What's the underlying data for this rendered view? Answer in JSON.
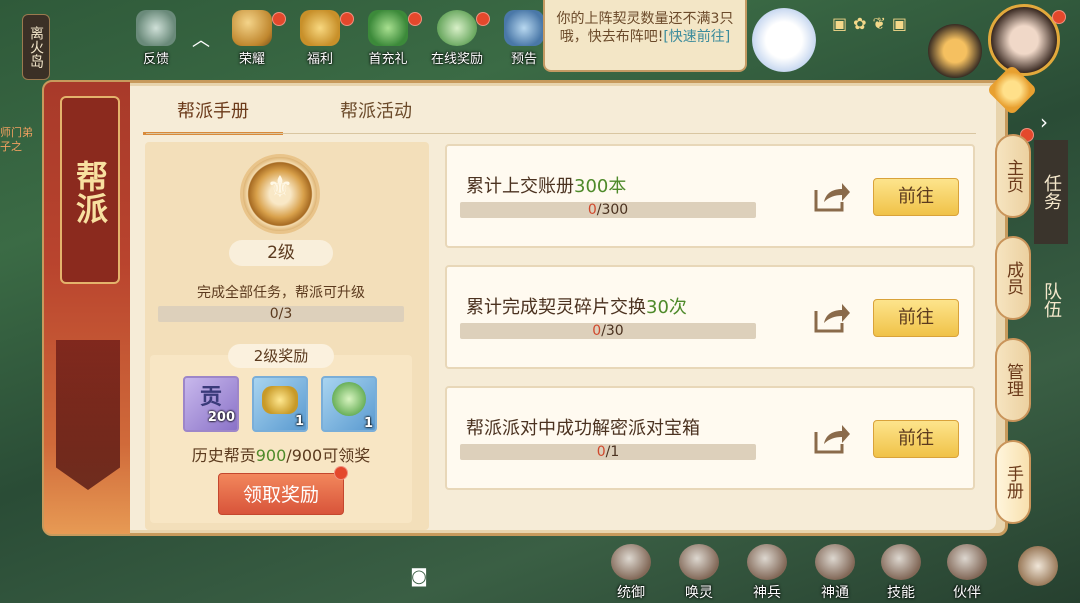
{
  "left_edge_label": "离火岛",
  "left_small_text": "师门弟子之",
  "top_icons": [
    {
      "label": "反馈",
      "icon": "feedback-icon"
    },
    {
      "label": "荣耀",
      "icon": "crown-icon"
    },
    {
      "label": "福利",
      "icon": "gift-icon"
    },
    {
      "label": "首充礼",
      "icon": "giftbox-icon"
    },
    {
      "label": "在线奖励",
      "icon": "coin-icon"
    },
    {
      "label": "预告",
      "icon": "sword-icon"
    }
  ],
  "notice": {
    "text": "你的上阵契灵数量还不满3只哦，快去布阵吧!",
    "link": "[快速前往]"
  },
  "panel": {
    "banner_title": "帮派",
    "tabs": [
      {
        "label": "帮派手册",
        "active": true
      },
      {
        "label": "帮派活动",
        "active": false
      }
    ],
    "level": {
      "label": "2级",
      "desc": "完成全部任务，帮派可升级",
      "progress_text": "0/3",
      "progress_fraction": 0
    },
    "reward": {
      "title": "2级奖励",
      "items": [
        {
          "icon": "contribution-icon",
          "glyph": "贡",
          "count": "200"
        },
        {
          "icon": "gold-ingot-icon",
          "count": "1"
        },
        {
          "icon": "spirit-coin-icon",
          "count": "1"
        }
      ],
      "history_prefix": "历史帮贡",
      "history_current": "900",
      "history_total": "/900",
      "history_suffix": "可领奖",
      "claim_label": "领取奖励"
    },
    "tasks": [
      {
        "title_prefix": "累计上交账册",
        "title_highlight": "300本",
        "title_suffix": "",
        "current": "0",
        "total": "/300",
        "progress_fraction": 0,
        "go_label": "前往"
      },
      {
        "title_prefix": "累计完成契灵碎片交换",
        "title_highlight": "30次",
        "title_suffix": "",
        "current": "0",
        "total": "/30",
        "progress_fraction": 0,
        "go_label": "前往"
      },
      {
        "title_prefix": "帮派派对中成功解密派对宝箱",
        "title_highlight": "",
        "title_suffix": "",
        "current": "0",
        "total": "/1",
        "progress_fraction": 0,
        "go_label": "前往"
      }
    ],
    "right_tabs": [
      {
        "label": "主页",
        "active": false
      },
      {
        "label": "成员",
        "active": false
      },
      {
        "label": "管理",
        "active": false
      },
      {
        "label": "手册",
        "active": true
      }
    ]
  },
  "outer_tabs": [
    "任务",
    "队伍"
  ],
  "bottom_icons": [
    {
      "label": "统御",
      "icon": "tiger-icon"
    },
    {
      "label": "唤灵",
      "icon": "eye-icon"
    },
    {
      "label": "神兵",
      "icon": "weapon-icon"
    },
    {
      "label": "神通",
      "icon": "mask-icon"
    },
    {
      "label": "技能",
      "icon": "scroll-icon"
    },
    {
      "label": "伙伴",
      "icon": "flag-icon"
    }
  ],
  "colors": {
    "accent_red": "#d0482c",
    "highlight_green": "#4e8a2a",
    "go_button": "#f0c248",
    "claim_button": "#d8543a"
  }
}
